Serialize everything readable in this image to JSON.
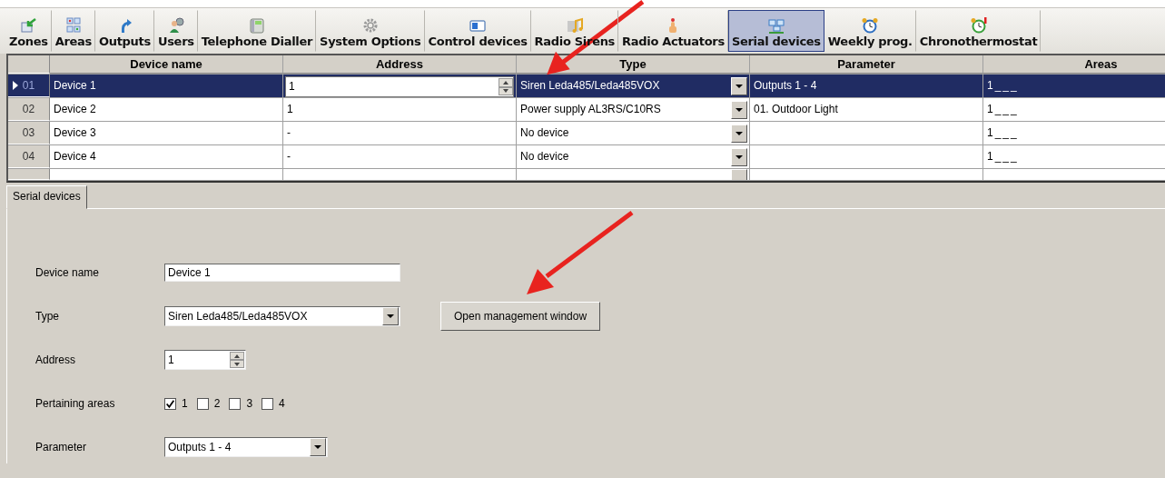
{
  "toolbar": [
    {
      "label": "Zones",
      "selected": false
    },
    {
      "label": "Areas",
      "selected": false
    },
    {
      "label": "Outputs",
      "selected": false
    },
    {
      "label": "Users",
      "selected": false
    },
    {
      "label": "Telephone Dialler",
      "selected": false
    },
    {
      "label": "System Options",
      "selected": false
    },
    {
      "label": "Control devices",
      "selected": false
    },
    {
      "label": "Radio Sirens",
      "selected": false
    },
    {
      "label": "Radio Actuators",
      "selected": false
    },
    {
      "label": "Serial devices",
      "selected": true
    },
    {
      "label": "Weekly prog.",
      "selected": false
    },
    {
      "label": "Chronothermostat",
      "selected": false
    }
  ],
  "grid": {
    "columns": [
      "Device name",
      "Address",
      "Type",
      "Parameter",
      "Areas"
    ],
    "rows": [
      {
        "number": "01",
        "name": "Device 1",
        "address": "1",
        "type": "Siren Leda485/Leda485VOX",
        "parameter": "Outputs 1 - 4",
        "areas": "1___",
        "selected": true
      },
      {
        "number": "02",
        "name": "Device 2",
        "address": "1",
        "type": "Power supply AL3RS/C10RS",
        "parameter": "01. Outdoor Light",
        "areas": "1___",
        "selected": false
      },
      {
        "number": "03",
        "name": "Device 3",
        "address": "-",
        "type": "No device",
        "parameter": "",
        "areas": "1___",
        "selected": false
      },
      {
        "number": "04",
        "name": "Device 4",
        "address": "-",
        "type": "No device",
        "parameter": "",
        "areas": "1___",
        "selected": false
      }
    ]
  },
  "tabs": [
    {
      "label": "Serial devices",
      "selected": true
    }
  ],
  "form": {
    "device_name": {
      "label": "Device name",
      "value": "Device 1"
    },
    "type": {
      "label": "Type",
      "value": "Siren Leda485/Leda485VOX"
    },
    "address": {
      "label": "Address",
      "value": "1"
    },
    "pertaining_areas": {
      "label": "Pertaining areas",
      "areas": [
        {
          "label": "1",
          "checked": true
        },
        {
          "label": "2",
          "checked": false
        },
        {
          "label": "3",
          "checked": false
        },
        {
          "label": "4",
          "checked": false
        }
      ]
    },
    "parameter": {
      "label": "Parameter",
      "value": "Outputs 1 - 4"
    },
    "open_button": "Open management window"
  }
}
